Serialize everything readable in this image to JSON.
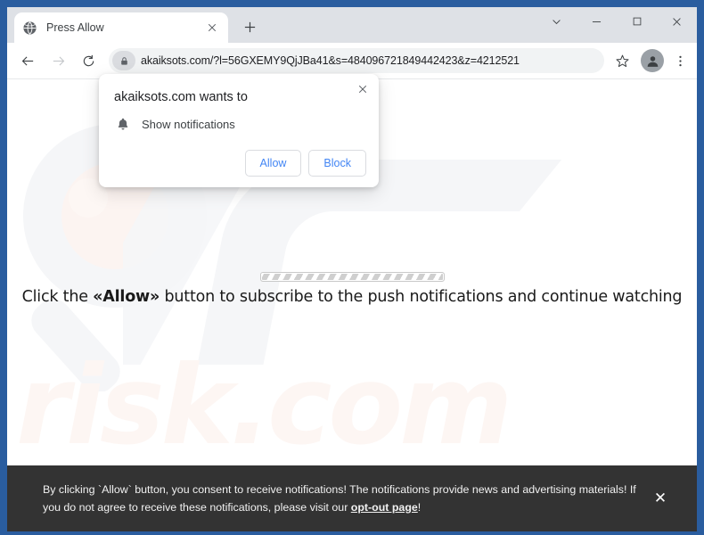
{
  "window": {
    "controls": [
      {
        "name": "tab-search",
        "glyph": "chevron-down"
      },
      {
        "name": "minimize",
        "glyph": "minimize"
      },
      {
        "name": "maximize",
        "glyph": "maximize"
      },
      {
        "name": "close",
        "glyph": "close"
      }
    ]
  },
  "tab": {
    "title": "Press Allow",
    "favicon": "globe-icon",
    "close_label": "×",
    "new_tab_label": "+"
  },
  "toolbar": {
    "back_label": "←",
    "forward_label": "→",
    "reload_label": "⟳",
    "url": "akaiksots.com/?l=56GXEMY9QjJBa41&s=484096721849442423&z=4212521",
    "lock_icon": "lock-icon",
    "star_icon": "star-icon",
    "profile_icon": "profile-avatar-icon",
    "menu_icon": "three-dot-menu-icon"
  },
  "page": {
    "watermark_text": "risk.com",
    "message_prefix": "Click the ",
    "message_highlight": "«Allow»",
    "message_suffix": " button to subscribe to the push notifications and continue watching",
    "progress_percent": 100
  },
  "dialog": {
    "title": "akaiksots.com wants to",
    "permission": "Show notifications",
    "permission_icon": "bell-icon",
    "close_label": "✕",
    "allow_label": "Allow",
    "block_label": "Block",
    "accent_color": "#4285f4"
  },
  "consent_banner": {
    "text_before_link": "By clicking `Allow` button, you consent to receive notifications! The notifications provide news and advertising materials! If you do not agree to receive these notifications, please visit our ",
    "link_label": "opt-out page",
    "text_after_link": "!",
    "close_label": "✕",
    "background_color": "#333333"
  }
}
